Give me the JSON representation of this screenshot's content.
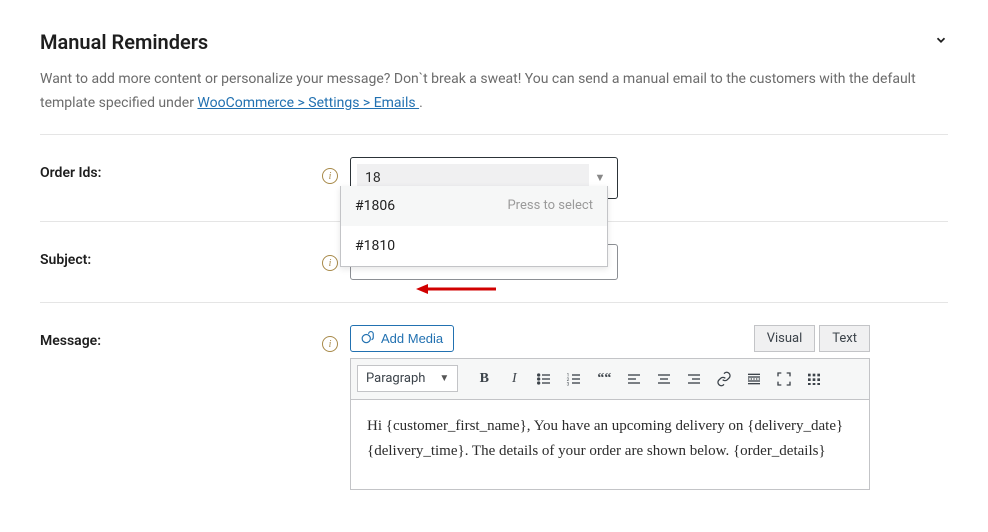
{
  "header": {
    "title": "Manual Reminders",
    "description_pre": "Want to add more content or personalize your message? Don`t break a sweat! You can send a manual email to the customers with the default template specified under ",
    "description_link": "WooCommerce > Settings > Emails ",
    "description_post": "."
  },
  "fields": {
    "order_ids": {
      "label": "Order Ids:",
      "input_value": "18",
      "options": [
        {
          "label": "#1806",
          "hint": "Press to select"
        },
        {
          "label": "#1810",
          "hint": ""
        }
      ]
    },
    "subject": {
      "label": "Subject:",
      "value": ""
    },
    "message": {
      "label": "Message:",
      "add_media": "Add Media",
      "tabs": {
        "visual": "Visual",
        "text": "Text"
      },
      "format_label": "Paragraph",
      "body": "Hi {customer_first_name}, You have an upcoming delivery on {delivery_date} {delivery_time}. The details of your order are shown below. {order_details}"
    }
  }
}
